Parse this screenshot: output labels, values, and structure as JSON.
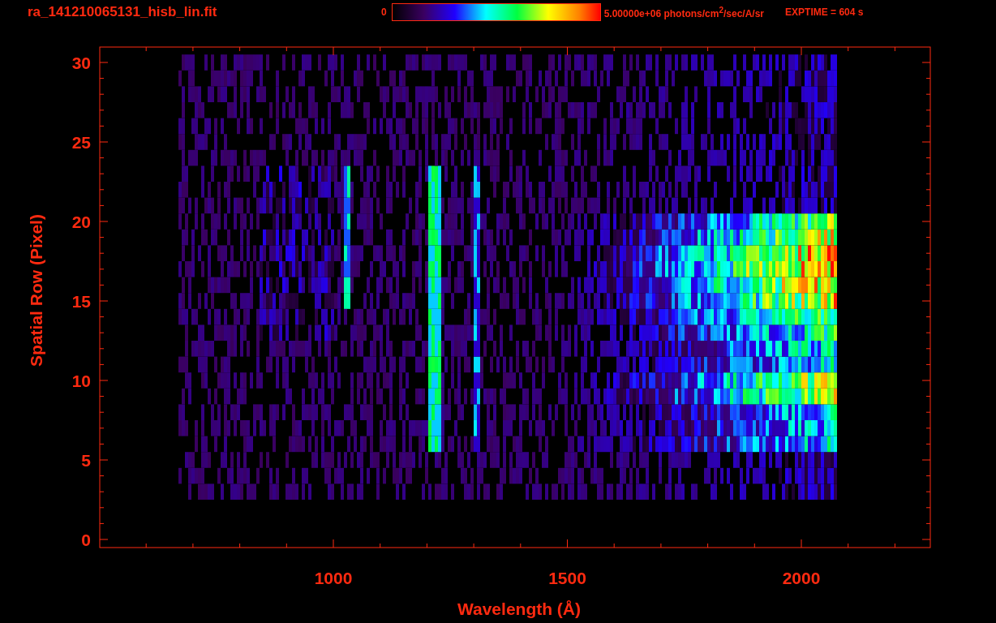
{
  "title": "ra_141210065131_hisb_lin.fit",
  "colorbar": {
    "min_label": "0",
    "max_label": "5.00000e+06 photons/cm$^{2}$/sec/A/sr"
  },
  "exposure": "EXPTIME = 604 s",
  "x_axis": {
    "title": "Wavelength (Å)",
    "ticks": [
      "1000",
      "1500",
      "2000"
    ]
  },
  "y_axis": {
    "title": "Spatial Row (Pixel)",
    "ticks": [
      "30",
      "25",
      "20",
      "15",
      "10",
      "5",
      "0"
    ]
  }
}
